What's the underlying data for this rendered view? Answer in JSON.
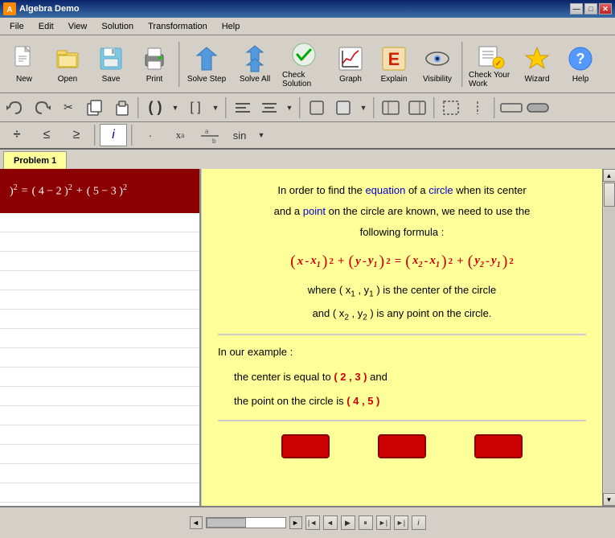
{
  "window": {
    "title": "Algebra Demo",
    "icon": "A"
  },
  "title_buttons": {
    "minimize": "—",
    "maximize": "□",
    "close": "✕"
  },
  "menu": {
    "items": [
      "File",
      "Edit",
      "View",
      "Solution",
      "Transformation",
      "Help"
    ]
  },
  "toolbar1": {
    "buttons": [
      {
        "label": "New",
        "icon": "📄"
      },
      {
        "label": "Open",
        "icon": "📂"
      },
      {
        "label": "Save",
        "icon": "💾"
      },
      {
        "label": "Print",
        "icon": "🖨"
      },
      {
        "label": "Solve Step",
        "icon": "⬇"
      },
      {
        "label": "Solve All",
        "icon": "⬇⬇"
      },
      {
        "label": "Check Solution",
        "icon": "✔"
      },
      {
        "label": "Graph",
        "icon": "📈"
      },
      {
        "label": "Explain",
        "icon": "📖"
      },
      {
        "label": "Visibility",
        "icon": "👁"
      },
      {
        "label": "Check Your Work",
        "icon": "✏"
      },
      {
        "label": "Wizard",
        "icon": "🎩"
      },
      {
        "label": "Help",
        "icon": "?"
      }
    ]
  },
  "tab": {
    "label": "Problem 1"
  },
  "equation": {
    "text": ") ² = ( 4 − 2 ) ² + ( 5 − 3 ) ²"
  },
  "explanation": {
    "para1": "In order to find the ",
    "equation_word": "equation",
    "para1b": " of a ",
    "circle_word": "circle",
    "para1c": " when its center and a ",
    "point_word": "point",
    "para1d": " on the circle are known, we need to use the following formula :",
    "formula_desc": "where ( x₁ , y₁ ) is the center of the circle",
    "formula_desc2": "and ( x₂ , y₂ ) is any point on the circle.",
    "our_example": "In our example :",
    "center_text": "the center is equal to ",
    "center_value": "( 2 , 3 )",
    "center_and": " and",
    "point_text": "the point on the circle is ",
    "point_value": "( 4 , 5 )"
  },
  "status": {
    "progress": 50
  }
}
